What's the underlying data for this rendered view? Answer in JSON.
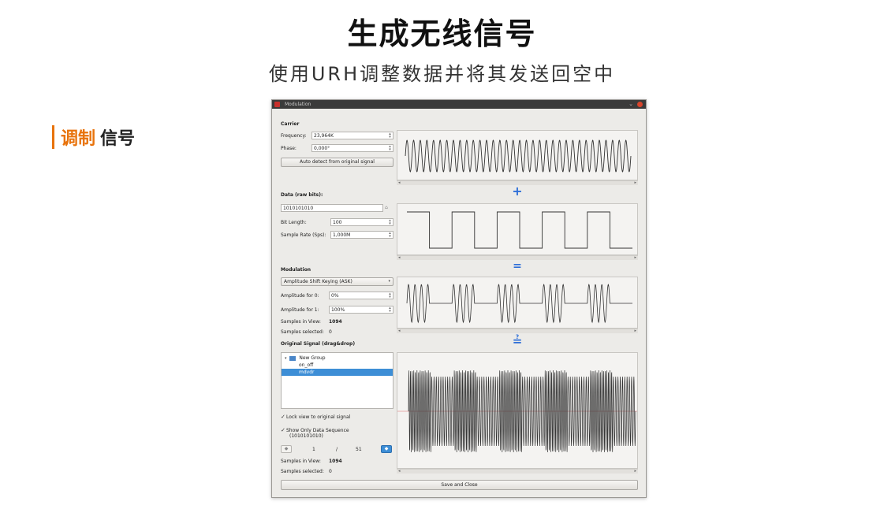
{
  "slide": {
    "title": "生成无线信号",
    "subtitle": "使用URH调整数据并将其发送回空中",
    "side_label_highlight": "调制",
    "side_label_rest": "信号",
    "accent_color": "#e8730c"
  },
  "window": {
    "title": "Modulation",
    "minimize_glyph": "⌄",
    "carrier": {
      "header": "Carrier",
      "frequency_label": "Frequency:",
      "frequency_value": "23,964K",
      "phase_label": "Phase:",
      "phase_value": "0,000°",
      "auto_detect_label": "Auto detect from original signal"
    },
    "data": {
      "header": "Data (raw bits):",
      "bits_value": "1010101010",
      "bits": [
        1,
        0,
        1,
        0,
        1,
        0,
        1,
        0,
        1,
        0
      ],
      "bit_length_label": "Bit Length:",
      "bit_length_value": "100",
      "sample_rate_label": "Sample Rate (Sps):",
      "sample_rate_value": "1,000M"
    },
    "modulation": {
      "header": "Modulation",
      "type_value": "Amplitude Shift Keying (ASK)",
      "amp0_label": "Amplitude for 0:",
      "amp0_value": "0%",
      "amp1_label": "Amplitude for 1:",
      "amp1_value": "100%",
      "samples_in_view_label": "Samples in View:",
      "samples_in_view_value": "1094",
      "samples_selected_label": "Samples selected:",
      "samples_selected_value": "0"
    },
    "operators": {
      "plus": "+",
      "equals": "=",
      "question_equals": "≟"
    },
    "original": {
      "header": "Original Signal (drag&drop)",
      "tree": [
        {
          "label": "New Group",
          "level": 0,
          "selected": false
        },
        {
          "label": "on_off",
          "level": 1,
          "selected": false
        },
        {
          "label": "mdvdr",
          "level": 1,
          "selected": true
        }
      ],
      "lock_view_label": "Lock view to original signal",
      "show_only_label": "Show Only Data Sequence",
      "show_only_sub": "(1010101010)",
      "check_glyph": "✓",
      "page_current": "1",
      "page_sep": "/",
      "page_total": "51",
      "samples_in_view_label": "Samples in View:",
      "samples_in_view_value": "1094",
      "samples_selected_label": "Samples selected:",
      "samples_selected_value": "0"
    },
    "save_close_label": "Save and Close"
  }
}
